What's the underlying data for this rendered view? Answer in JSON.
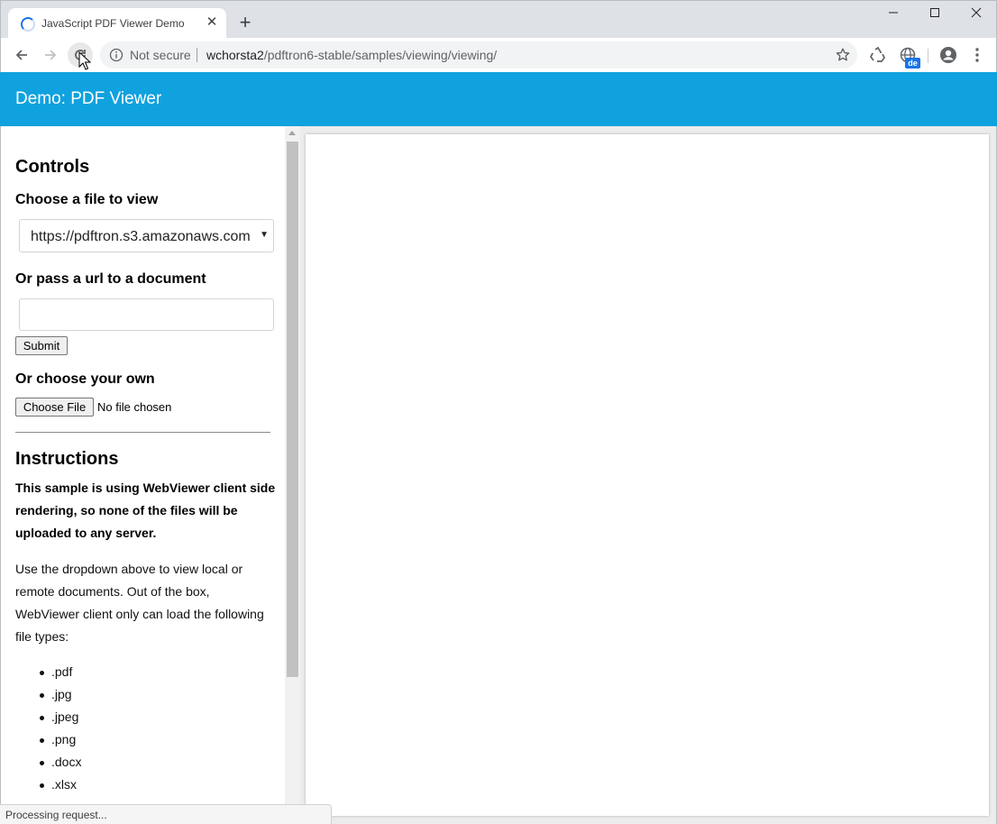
{
  "browser": {
    "tab_title": "JavaScript PDF Viewer Demo",
    "security_label": "Not secure",
    "url_host": "wchorsta2",
    "url_path": "/pdftron6-stable/samples/viewing/viewing/",
    "extension_badge": "de",
    "status_text": "Processing request..."
  },
  "header": {
    "title": "Demo: PDF Viewer"
  },
  "sidebar": {
    "controls_heading": "Controls",
    "choose_file_label": "Choose a file to view",
    "file_select_value": "https://pdftron.s3.amazonaws.com",
    "url_label": "Or pass a url to a document",
    "url_input_value": "",
    "submit_label": "Submit",
    "own_label": "Or choose your own",
    "choose_file_button": "Choose File",
    "no_file_text": "No file chosen",
    "instructions_heading": "Instructions",
    "instructions_bold": "This sample is using WebViewer client side rendering, so none of the files will be uploaded to any server.",
    "instructions_text": "Use the dropdown above to view local or remote documents. Out of the box, WebViewer client only can load the following file types:",
    "file_types": [
      ".pdf",
      ".jpg",
      ".jpeg",
      ".png",
      ".docx",
      ".xlsx"
    ]
  },
  "colors": {
    "header_bg": "#10a2df",
    "accent": "#1a73e8"
  }
}
